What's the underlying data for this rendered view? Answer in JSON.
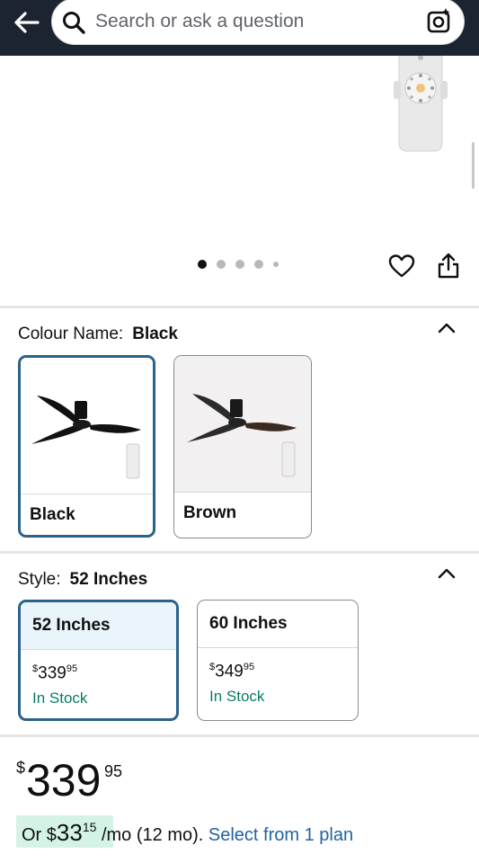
{
  "search": {
    "placeholder": "Search or ask a question"
  },
  "gallery": {
    "dot_count": 5,
    "active_index": 0
  },
  "colour": {
    "label": "Colour Name:",
    "selected": "Black",
    "options": [
      {
        "name": "Black",
        "selected": true
      },
      {
        "name": "Brown",
        "selected": false
      }
    ]
  },
  "style": {
    "label": "Style:",
    "selected": "52 Inches",
    "options": [
      {
        "name": "52 Inches",
        "currency": "$",
        "price_whole": "339",
        "price_fraction": "95",
        "stock": "In Stock",
        "selected": true
      },
      {
        "name": "60 Inches",
        "currency": "$",
        "price_whole": "349",
        "price_fraction": "95",
        "stock": "In Stock",
        "selected": false
      }
    ]
  },
  "price": {
    "currency": "$",
    "whole": "339",
    "fraction": "95"
  },
  "plan": {
    "prefix": "Or ",
    "currency": "$",
    "amount_whole": "33",
    "amount_fraction": "15",
    "suffix": "/mo (12 mo).",
    "link": "Select from 1 plan"
  },
  "colors": {
    "header_bg": "#1b2430",
    "selected_border": "#2a6289",
    "stock_green": "#067D62",
    "link_blue": "#2162a1",
    "plan_highlight": "#d4f2e6"
  }
}
